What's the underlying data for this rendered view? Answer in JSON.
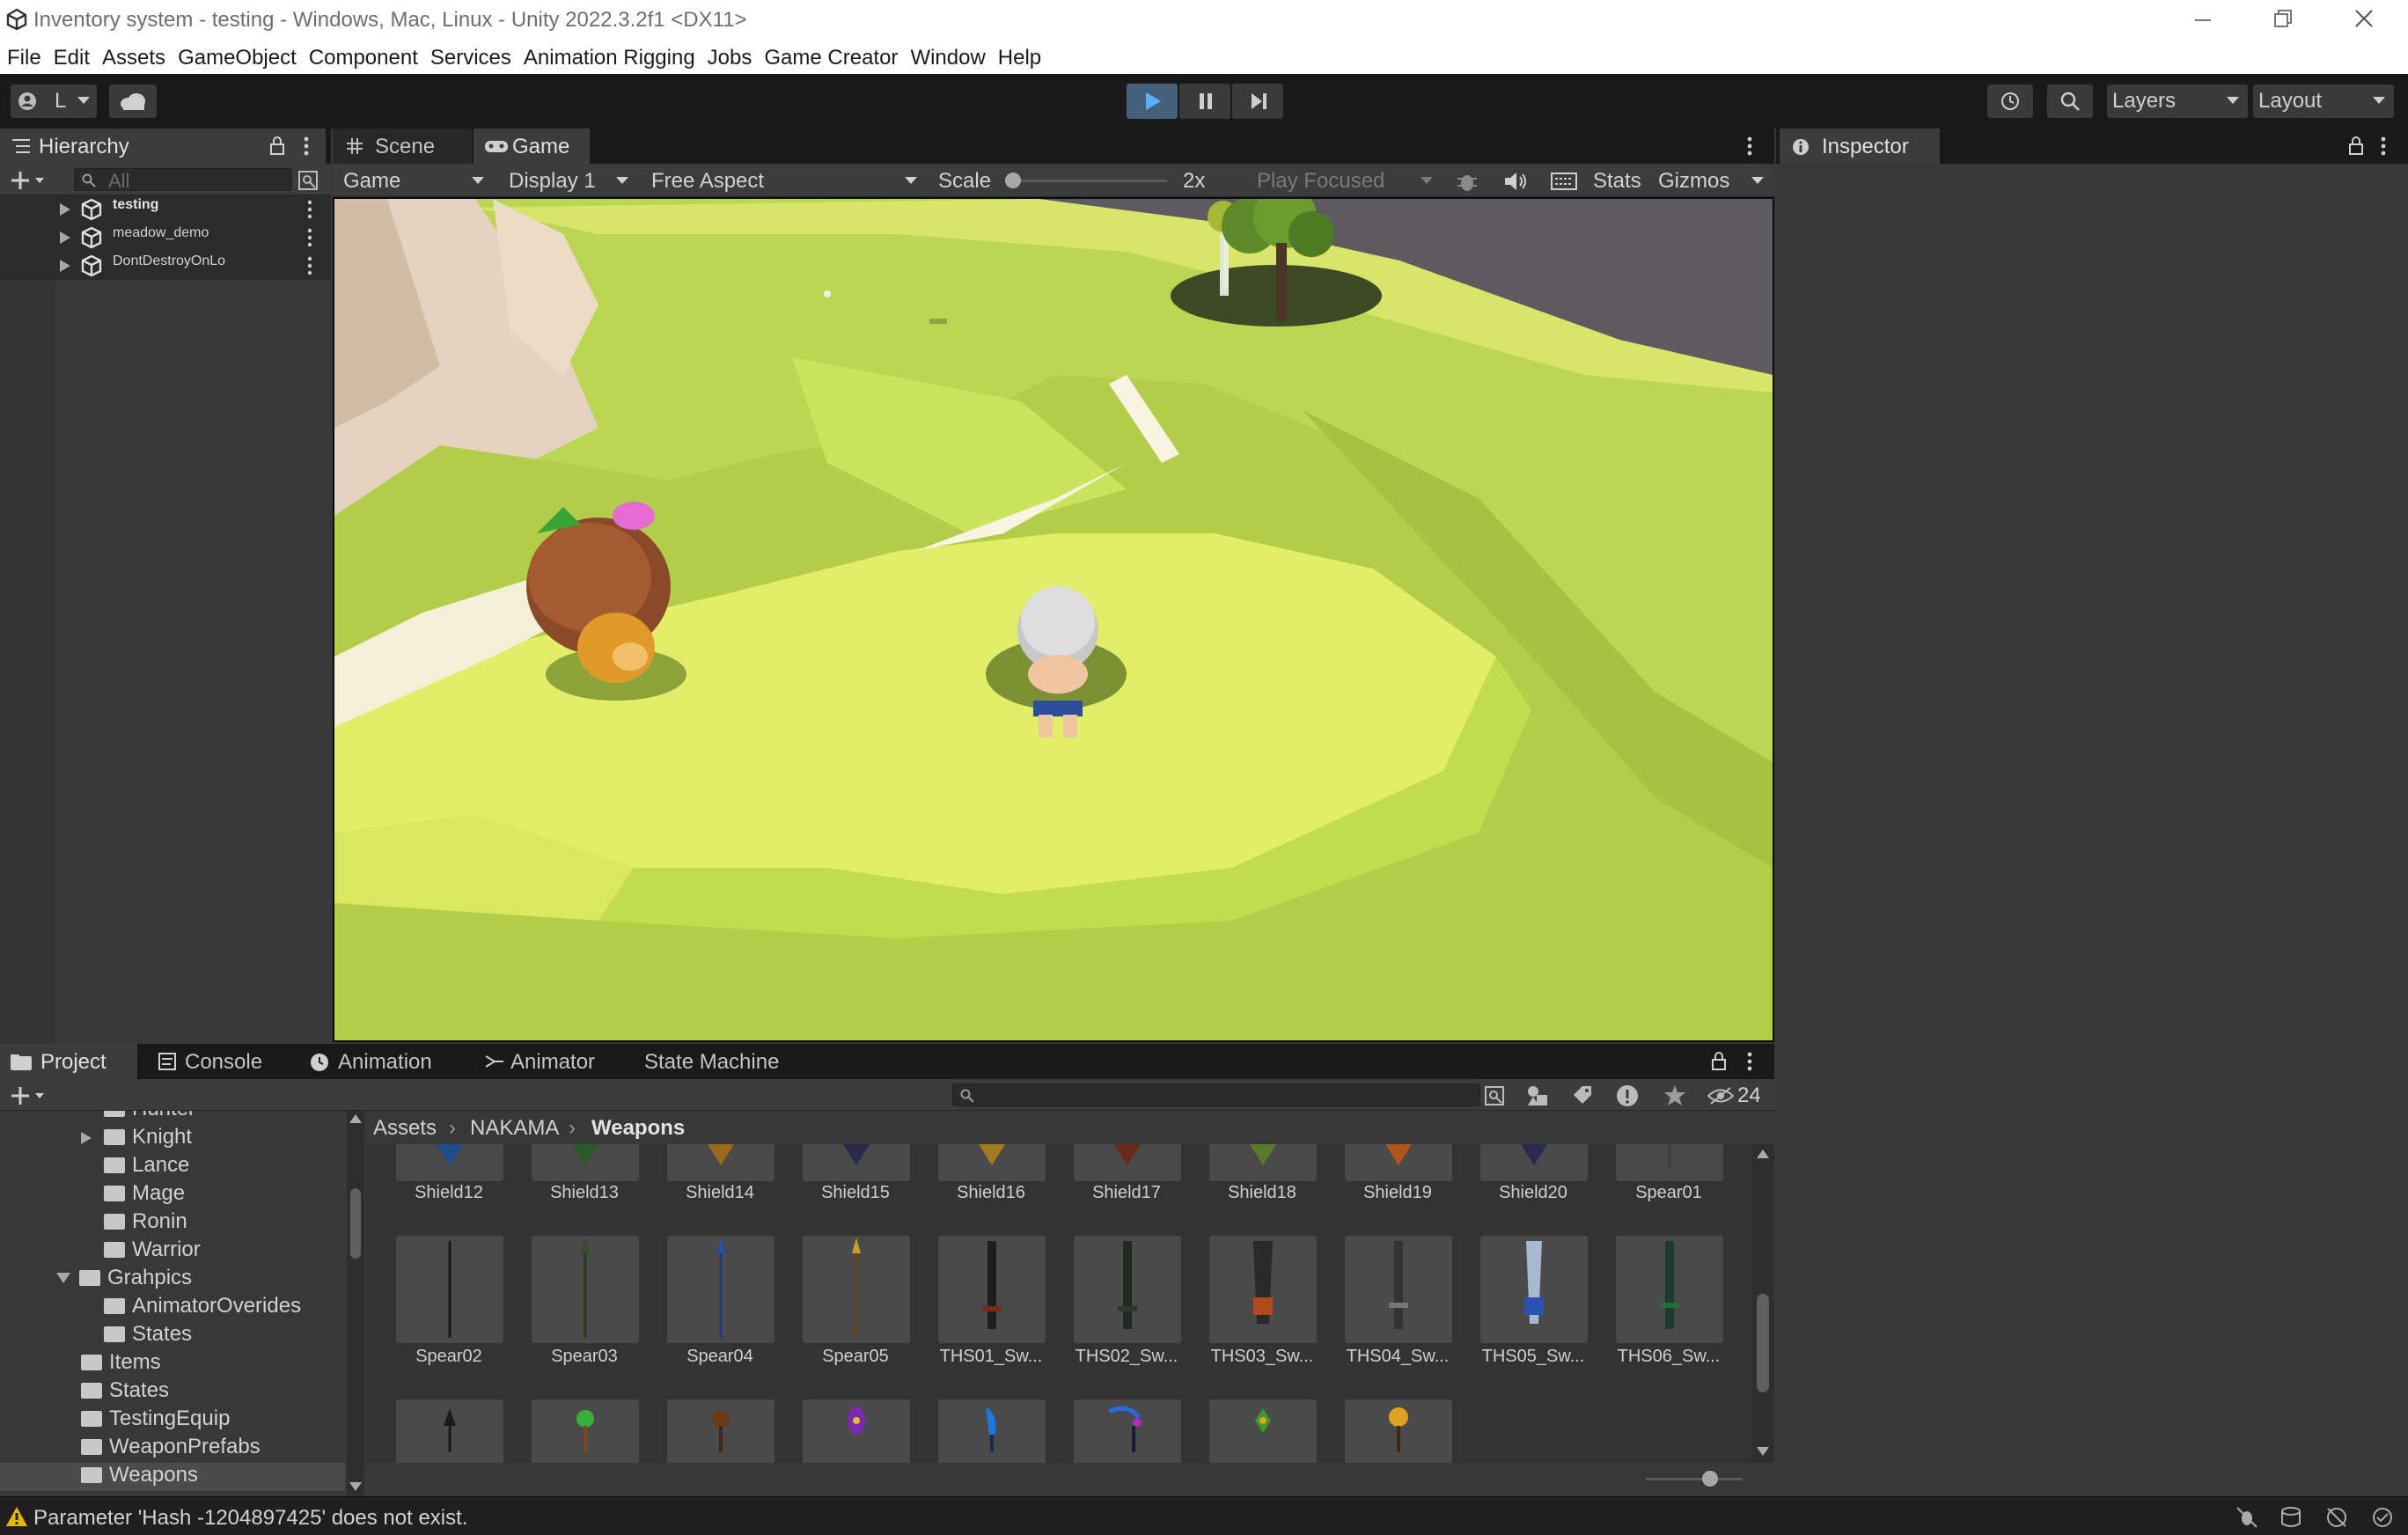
{
  "window": {
    "title": "Inventory system - testing - Windows, Mac, Linux - Unity 2022.3.2f1 <DX11>"
  },
  "menu": [
    "File",
    "Edit",
    "Assets",
    "GameObject",
    "Component",
    "Services",
    "Animation Rigging",
    "Jobs",
    "Game Creator",
    "Window",
    "Help"
  ],
  "toolbar": {
    "account": "L",
    "layers": "Layers",
    "layout": "Layout"
  },
  "hierarchy": {
    "tab": "Hierarchy",
    "search_placeholder": "All",
    "items": [
      "testing",
      "meadow_demo",
      "DontDestroyOnLo"
    ]
  },
  "scene_tabs": {
    "scene": "Scene",
    "game": "Game"
  },
  "game_toolbar": {
    "mode": "Game",
    "display": "Display 1",
    "aspect": "Free Aspect",
    "scale_label": "Scale",
    "scale_value": "2x",
    "play_focused": "Play Focused",
    "stats": "Stats",
    "gizmos": "Gizmos"
  },
  "inspector": {
    "tab": "Inspector"
  },
  "bottom_tabs": {
    "project": "Project",
    "console": "Console",
    "animation": "Animation",
    "animator": "Animator",
    "state_machine": "State Machine"
  },
  "project": {
    "hidden_count": "24",
    "breadcrumb": [
      "Assets",
      "NAKAMA",
      "Weapons"
    ],
    "tree": [
      {
        "label": "Hunter",
        "indent": 2,
        "arrow": false
      },
      {
        "label": "Knight",
        "indent": 2,
        "arrow": true
      },
      {
        "label": "Lance",
        "indent": 2,
        "arrow": false
      },
      {
        "label": "Mage",
        "indent": 2,
        "arrow": false
      },
      {
        "label": "Ronin",
        "indent": 2,
        "arrow": false
      },
      {
        "label": "Warrior",
        "indent": 2,
        "arrow": false
      },
      {
        "label": "Grahpics",
        "indent": 1,
        "arrow": true,
        "open": true
      },
      {
        "label": "AnimatorOverides",
        "indent": 2,
        "arrow": false
      },
      {
        "label": "States",
        "indent": 2,
        "arrow": false
      },
      {
        "label": "Items",
        "indent": 1,
        "arrow": false
      },
      {
        "label": "States",
        "indent": 1,
        "arrow": false
      },
      {
        "label": "TestingEquip",
        "indent": 1,
        "arrow": false
      },
      {
        "label": "WeaponPrefabs",
        "indent": 1,
        "arrow": false
      },
      {
        "label": "Weapons",
        "indent": 1,
        "arrow": false,
        "selected": true
      }
    ],
    "row1": [
      "Shield12",
      "Shield13",
      "Shield14",
      "Shield15",
      "Shield16",
      "Shield17",
      "Shield18",
      "Shield19",
      "Shield20",
      "Spear01"
    ],
    "row2": [
      "Spear02",
      "Spear03",
      "Spear04",
      "Spear05",
      "THS01_Sw...",
      "THS02_Sw...",
      "THS03_Sw...",
      "THS04_Sw...",
      "THS05_Sw...",
      "THS06_Sw..."
    ],
    "row3_count": 8
  },
  "status": {
    "message": "Parameter 'Hash -1204897425' does not exist.",
    "warning_color": "#e6b800"
  }
}
